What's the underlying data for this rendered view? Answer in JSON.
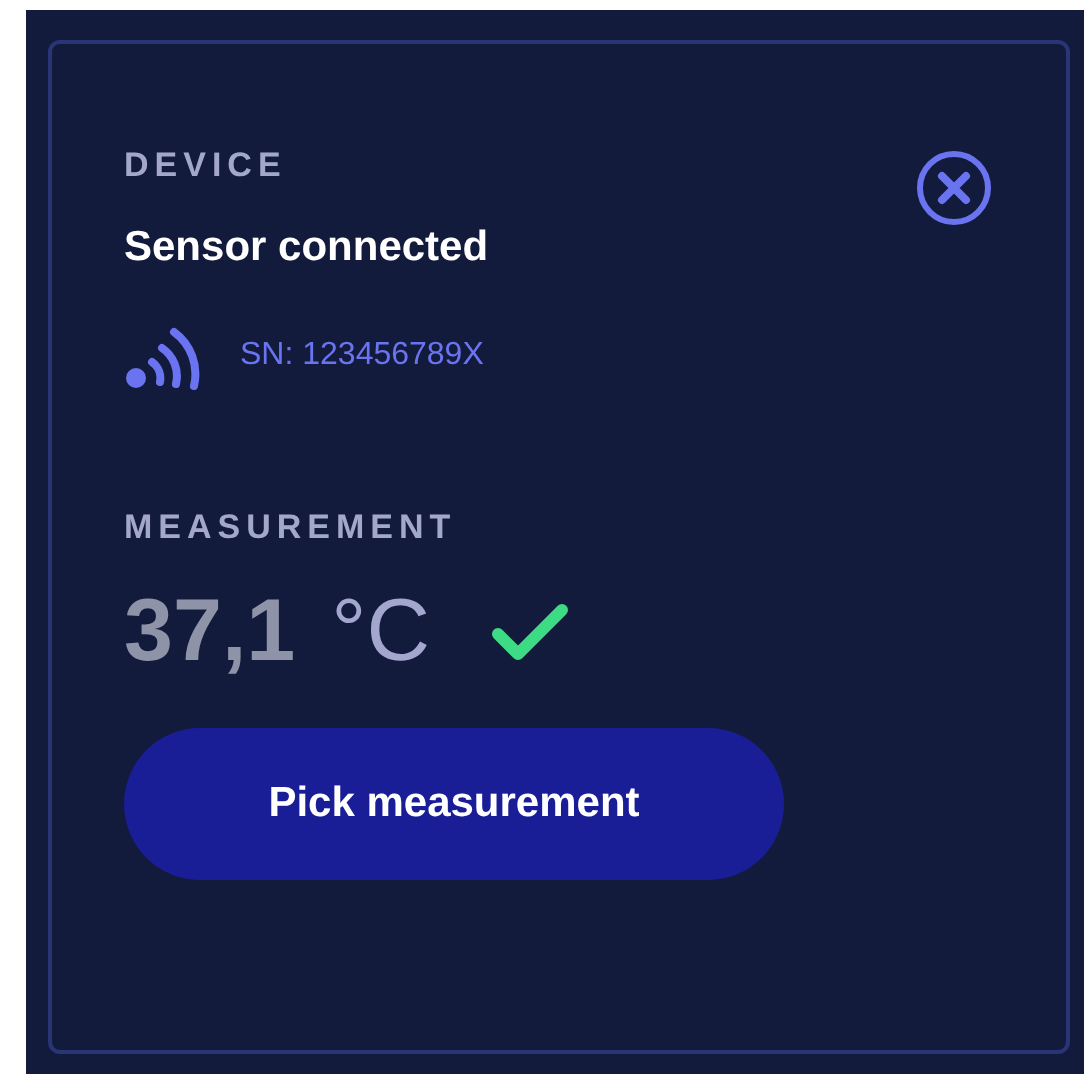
{
  "device": {
    "heading": "DEVICE",
    "status": "Sensor connected",
    "serial": "SN: 123456789X"
  },
  "measurement": {
    "heading": "MEASUREMENT",
    "value": "37,1",
    "unit": "°C",
    "valid": true
  },
  "button": {
    "label": "Pick measurement"
  }
}
